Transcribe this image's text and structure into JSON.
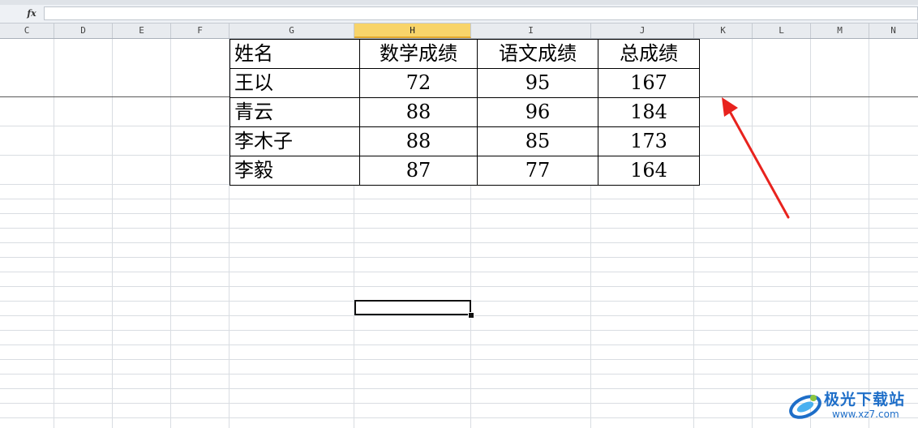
{
  "column_headers": [
    "C",
    "D",
    "E",
    "F",
    "G",
    "H",
    "I",
    "J",
    "K",
    "L",
    "M",
    "N"
  ],
  "selected_column": "H",
  "table": {
    "headers": [
      "姓名",
      "数学成绩",
      "语文成绩",
      "总成绩"
    ],
    "rows": [
      [
        "王以",
        "72",
        "95",
        "167"
      ],
      [
        "青云",
        "88",
        "96",
        "184"
      ],
      [
        "李木子",
        "88",
        "85",
        "173"
      ],
      [
        "李毅",
        "87",
        "77",
        "164"
      ]
    ]
  },
  "watermark": {
    "brand": "极光下载站",
    "url": "www.xz7.com"
  },
  "colors": {
    "selected_header": "#f8d46a",
    "annotation_arrow": "#e8231e",
    "logo": "#1e6ec8"
  }
}
